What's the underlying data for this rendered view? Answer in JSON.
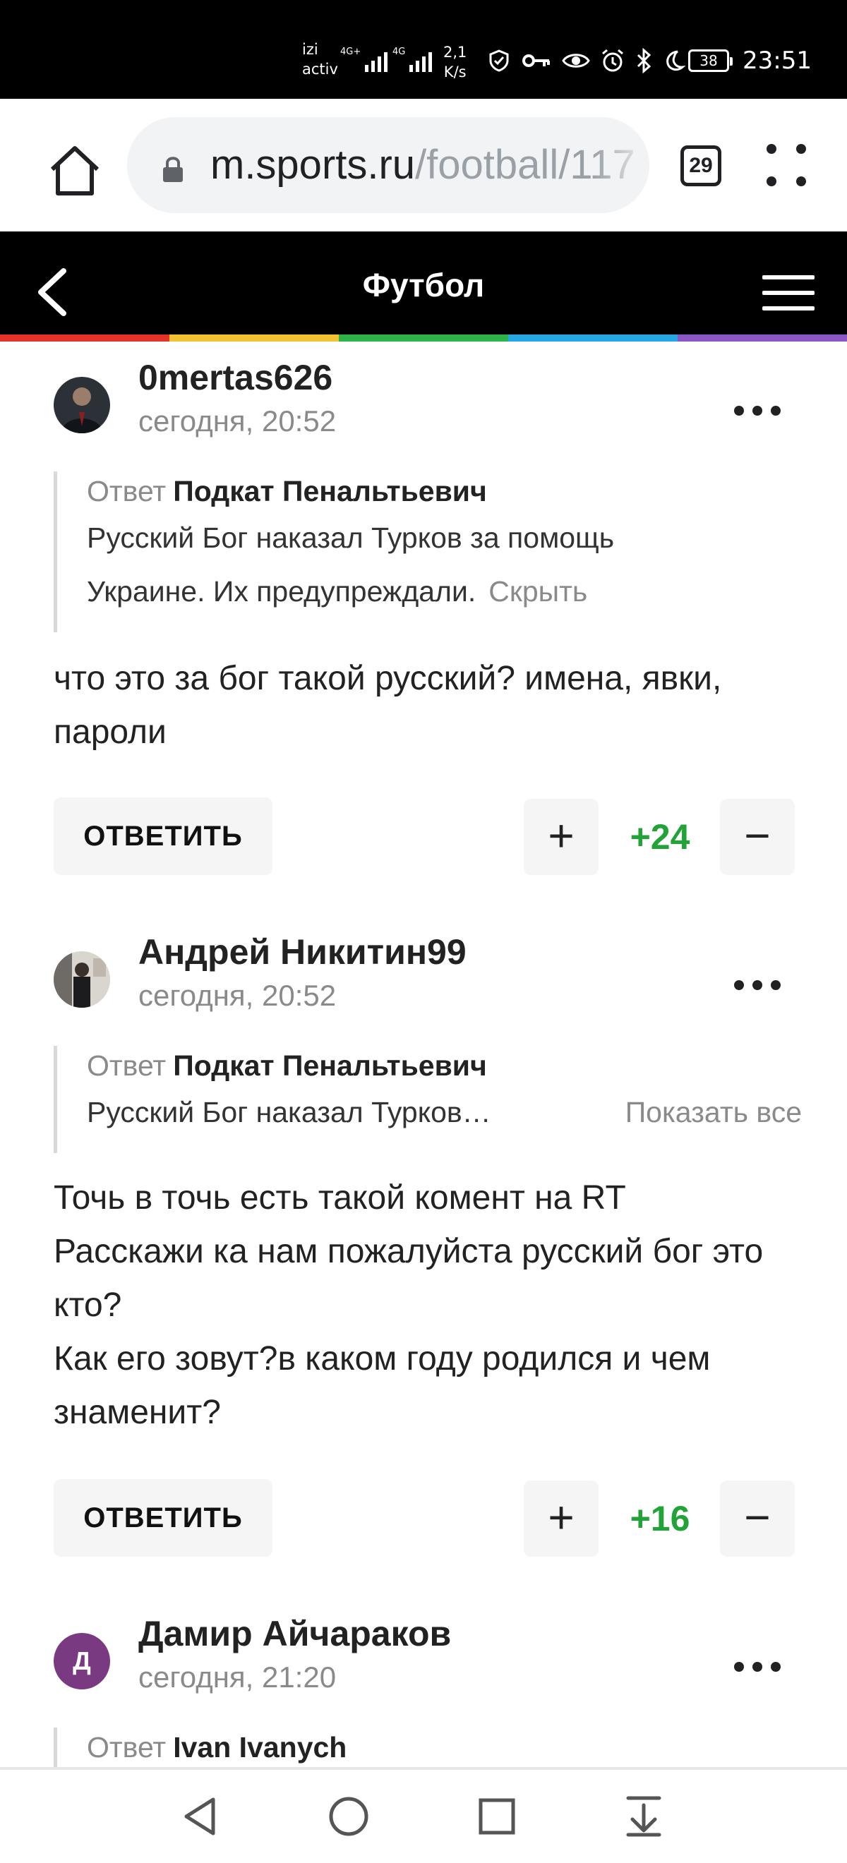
{
  "status_bar": {
    "carrier_line1": "izi",
    "carrier_line2": "activ",
    "net1": "4G+",
    "net2": "4G",
    "speed_line1": "2,1",
    "speed_line2": "K/s",
    "battery": "38",
    "time": "23:51",
    "icons": [
      "shield-icon",
      "key-icon",
      "eye-icon",
      "alarm-icon",
      "bluetooth-icon",
      "moon-icon"
    ]
  },
  "browser": {
    "url_host": "m.sports.ru",
    "url_path": "/football/117",
    "tab_count": "29"
  },
  "header": {
    "title": "Футбол",
    "rainbow": [
      "#e4322b",
      "#f2c230",
      "#2db34a",
      "#27a6e4",
      "#8b57c7"
    ]
  },
  "comments": [
    {
      "author": "0mertas626",
      "time": "сегодня, 20:52",
      "quote_label": "Ответ",
      "quote_author": "Подкат Пенальтьевич",
      "quote_text": "Русский Бог наказал Турков за помощь Украине. Их предупреждали.",
      "quote_link": "Скрыть",
      "body": "что это за бог такой русский? имена, явки, пароли",
      "reply_label": "ОТВЕТИТЬ",
      "plus": "+",
      "score": "+24",
      "minus": "−"
    },
    {
      "author": "Андрей Никитин99",
      "time": "сегодня, 20:52",
      "quote_label": "Ответ",
      "quote_author": "Подкат Пенальтьевич",
      "quote_text": "Русский Бог наказал Турков…",
      "quote_link": "Показать все",
      "body": "Точь в точь есть такой комент на RT\nРасскажи ка нам пожалуйста русский бог это кто?\nКак его зовут?в каком году родился и чем знаменит?",
      "reply_label": "ОТВЕТИТЬ",
      "plus": "+",
      "score": "+16",
      "minus": "−"
    },
    {
      "author": "Дамир Айчараков",
      "avatar_letter": "Д",
      "time": "сегодня, 21:20",
      "quote_label": "Ответ",
      "quote_author": "Ivan Ivanych"
    }
  ]
}
